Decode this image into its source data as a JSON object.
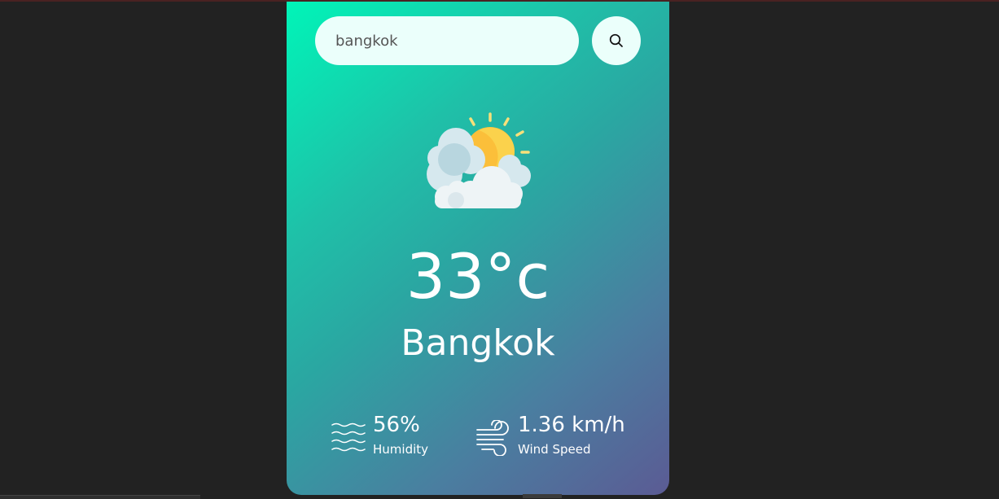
{
  "search": {
    "value": "bangkok",
    "placeholder": "",
    "button_icon": "search-icon"
  },
  "weather": {
    "icon": "partly-cloudy-sun-icon",
    "temperature": "33°c",
    "city": "Bangkok"
  },
  "details": {
    "humidity": {
      "icon": "humidity-icon",
      "value": "56%",
      "label": "Humidity"
    },
    "wind": {
      "icon": "wind-icon",
      "value": "1.36 km/h",
      "label": "Wind Speed"
    }
  },
  "colors": {
    "background": "#222222",
    "card_gradient_start": "#00f5b8",
    "card_gradient_end": "#5b5b94",
    "input_bg": "#ebfffb",
    "sun": "#fbbf3a",
    "cloud": "#e8f0f3"
  }
}
